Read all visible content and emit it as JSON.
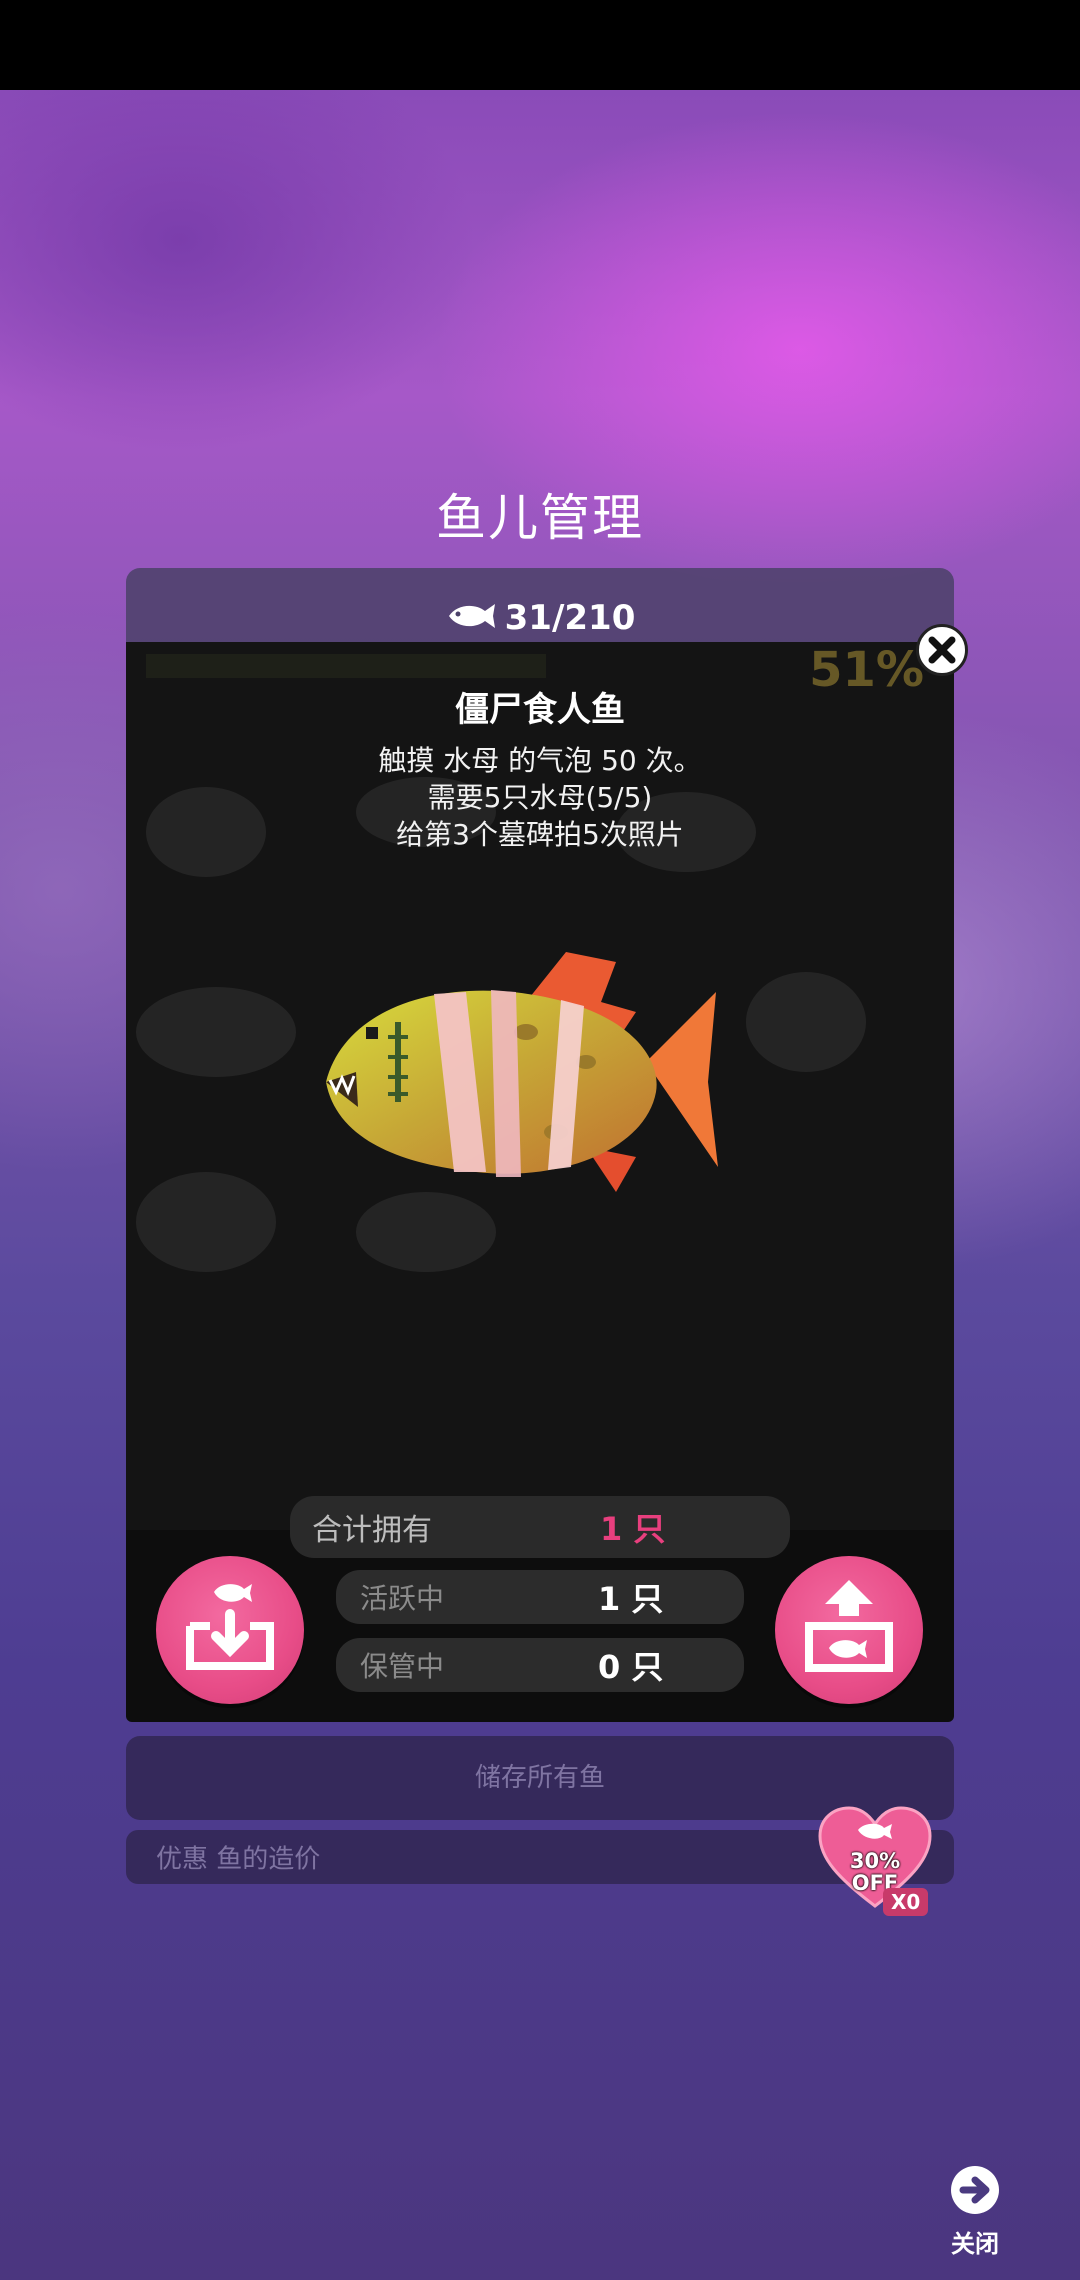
{
  "header": {
    "title": "鱼儿管理",
    "fish_count": "31/210",
    "collection_percent": "51%"
  },
  "fish_detail": {
    "name": "僵尸食人鱼",
    "requirements": [
      "触摸 水母 的气泡 50 次。",
      "需要5只水母(5/5)",
      "给第3个墓碑拍5次照片"
    ]
  },
  "ownership": {
    "total_label": "合计拥有",
    "total_value": "1 只",
    "active_label": "活跃中",
    "active_value": "1 只",
    "stored_label": "保管中",
    "stored_value": "0 只"
  },
  "buttons": {
    "store_all_label": "储存所有鱼",
    "store_icon": "store-fish-icon",
    "release_icon": "release-fish-icon",
    "close_label": "关闭"
  },
  "discount": {
    "label": "优惠 鱼的造价",
    "badge_line1": "30%",
    "badge_line2": "OFF",
    "badge_count": "X0"
  },
  "colors": {
    "accent_pink": "#e84d88",
    "total_value": "#e83f7e",
    "card_bg": "#141414"
  }
}
